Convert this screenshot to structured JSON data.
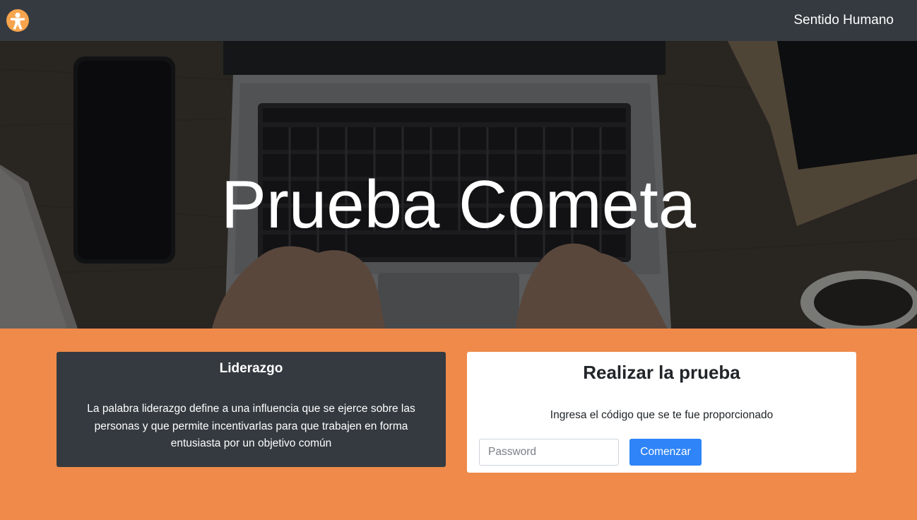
{
  "navbar": {
    "logo_icon": "person-accessibility-icon",
    "brand": "Sentido Humano"
  },
  "hero": {
    "title": "Prueba Cometa"
  },
  "info_card": {
    "title": "Liderazgo",
    "text": "La palabra liderazgo define a una influencia que se ejerce sobre las personas y que permite incentivarlas para que trabajen en forma entusiasta por un objetivo común"
  },
  "test_card": {
    "title": "Realizar la prueba",
    "subtitle": "Ingresa el código que se te fue proporcionado",
    "password_placeholder": "Password",
    "password_value": "",
    "start_button": "Comenzar"
  },
  "colors": {
    "navbar": "#343a40",
    "page_background": "#ef8a4a",
    "logo": "#f6a44d",
    "primary_button": "#2f84f7"
  }
}
